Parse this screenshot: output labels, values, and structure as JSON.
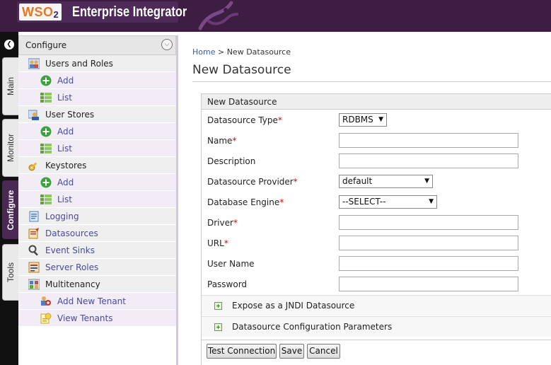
{
  "header": {
    "logo_text": "WSO",
    "logo_sub": "2",
    "product_name": "Enterprise Integrator"
  },
  "side_tabs": [
    {
      "label": "Main",
      "active": false
    },
    {
      "label": "Monitor",
      "active": false
    },
    {
      "label": "Configure",
      "active": true
    },
    {
      "label": "Tools",
      "active": false
    }
  ],
  "nav": {
    "title": "Configure",
    "items": [
      {
        "label": "Users and Roles",
        "kind": "cat",
        "icon": "users-icon"
      },
      {
        "label": "Add",
        "kind": "sub",
        "icon": "add-icon"
      },
      {
        "label": "List",
        "kind": "sub",
        "icon": "list-icon"
      },
      {
        "label": "User Stores",
        "kind": "cat",
        "icon": "user-store-icon"
      },
      {
        "label": "Add",
        "kind": "sub",
        "icon": "add-icon"
      },
      {
        "label": "List",
        "kind": "sub",
        "icon": "list-icon"
      },
      {
        "label": "Keystores",
        "kind": "cat",
        "icon": "key-icon"
      },
      {
        "label": "Add",
        "kind": "sub",
        "icon": "add-icon"
      },
      {
        "label": "List",
        "kind": "sub",
        "icon": "list-icon"
      },
      {
        "label": "Logging",
        "kind": "cat-link",
        "icon": "logging-icon"
      },
      {
        "label": "Datasources",
        "kind": "cat-link",
        "icon": "datasource-icon"
      },
      {
        "label": "Event Sinks",
        "kind": "cat-link",
        "icon": "event-sink-icon"
      },
      {
        "label": "Server Roles",
        "kind": "cat-link",
        "icon": "server-roles-icon"
      },
      {
        "label": "Multitenancy",
        "kind": "cat",
        "icon": "multitenancy-icon"
      },
      {
        "label": "Add New Tenant",
        "kind": "sub",
        "icon": "add-tenant-icon"
      },
      {
        "label": "View Tenants",
        "kind": "sub",
        "icon": "view-tenants-icon"
      }
    ]
  },
  "main": {
    "breadcrumb_home": "Home",
    "breadcrumb_sep": " > ",
    "breadcrumb_current": "New Datasource",
    "page_title": "New Datasource",
    "form": {
      "title": "New Datasource",
      "fields": {
        "type_label": "Datasource Type",
        "type_value": "RDBMS",
        "name_label": "Name",
        "description_label": "Description",
        "provider_label": "Datasource Provider",
        "provider_value": "default",
        "engine_label": "Database Engine",
        "engine_value": "--SELECT--",
        "driver_label": "Driver",
        "url_label": "URL",
        "username_label": "User Name",
        "password_label": "Password"
      },
      "required_mark": "*",
      "sections": {
        "jndi": "Expose as a JNDI Datasource",
        "config": "Datasource Configuration Parameters"
      },
      "buttons": {
        "test": "Test Connection",
        "save": "Save",
        "cancel": "Cancel"
      }
    }
  },
  "colors": {
    "header_bg": "#3e1d42",
    "accent_purple": "#4a2a55",
    "link_blue": "#4a4a9a",
    "required_red": "#dd0000"
  }
}
